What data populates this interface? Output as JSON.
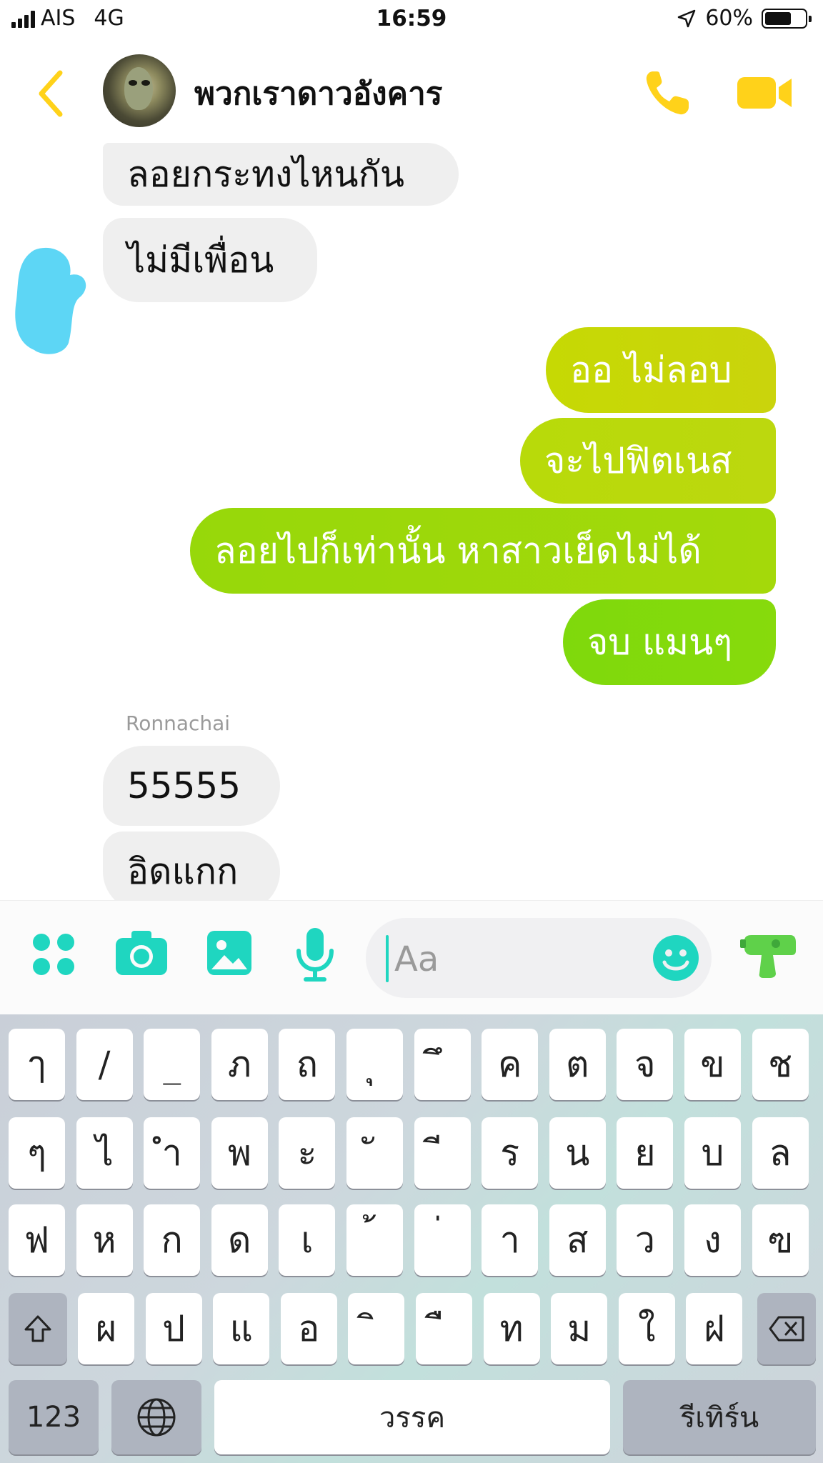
{
  "status_bar": {
    "carrier": "AIS",
    "network": "4G",
    "time": "16:59",
    "battery_percent": "60%",
    "battery_level": 0.6
  },
  "header": {
    "title": "พวกเราดาวอังคาร",
    "accent_color": "#ffd21a"
  },
  "messages": {
    "m1": "ลอยกระทงไหนกัน",
    "m2": "ไม่มีเพื่อน",
    "m3": "ออ ไม่ลอบ",
    "m4": "จะไปฟิตเนส",
    "m5": "ลอยไปก็เท่านั้น หาสาวเย็ดไม่ได้",
    "m6": "จบ แมนๆ",
    "sender": "Ronnachai",
    "m7": "55555",
    "m8": "อิดแกก"
  },
  "composer": {
    "placeholder": "Aa",
    "accent_color": "#1fd6c0",
    "icons": [
      "more-apps-icon",
      "camera-icon",
      "image-icon",
      "microphone-icon",
      "emoji-icon",
      "water-gun-icon"
    ]
  },
  "keyboard": {
    "row1": [
      "ๅ",
      "/",
      "_",
      "ภ",
      "ถ",
      "ุ",
      "ึ",
      "ค",
      "ต",
      "จ",
      "ข",
      "ช"
    ],
    "row2": [
      "ๆ",
      "ไ",
      "ำ",
      "พ",
      "ะ",
      "ั",
      "ี",
      "ร",
      "น",
      "ย",
      "บ",
      "ล"
    ],
    "row3": [
      "ฟ",
      "ห",
      "ก",
      "ด",
      "เ",
      "้",
      "่",
      "า",
      "ส",
      "ว",
      "ง",
      "ฃ"
    ],
    "row4": [
      "ผ",
      "ป",
      "แ",
      "อ",
      "ิ",
      "ื",
      "ท",
      "ม",
      "ใ",
      "ฝ"
    ],
    "numbers_label": "123",
    "space_label": "วรรค",
    "return_label": "รีเทิร์น"
  }
}
